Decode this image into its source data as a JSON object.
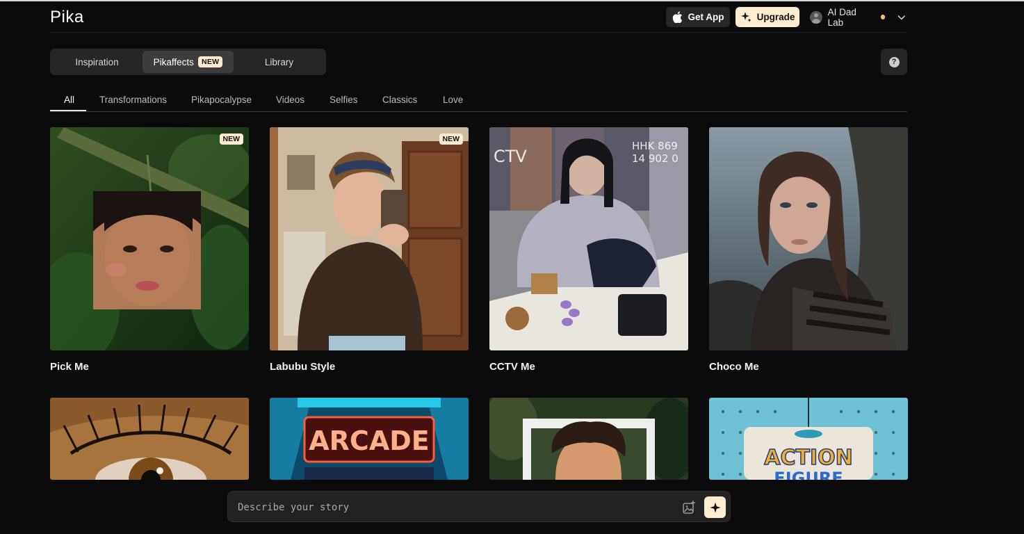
{
  "header": {
    "logo": "Pika",
    "get_app_label": "Get App",
    "upgrade_label": "Upgrade",
    "account_name": "AI Dad Lab"
  },
  "segments": {
    "items": [
      {
        "label": "Inspiration",
        "active": false
      },
      {
        "label": "Pikaffects",
        "active": true,
        "badge": "NEW"
      },
      {
        "label": "Library",
        "active": false
      }
    ]
  },
  "help_label": "?",
  "categories": [
    "All",
    "Transformations",
    "Pikapocalypse",
    "Videos",
    "Selfies",
    "Classics",
    "Love"
  ],
  "active_category": "All",
  "cards": [
    {
      "title": "Pick Me",
      "badge": "NEW"
    },
    {
      "title": "Labubu Style",
      "badge": "NEW"
    },
    {
      "title": "CCTV Me",
      "badge": ""
    },
    {
      "title": "Choco Me",
      "badge": ""
    }
  ],
  "cards_row2": [
    {
      "label": "",
      "icon": "eye-closeup-image"
    },
    {
      "label": "ARCADE",
      "icon": "arcade-sign-image"
    },
    {
      "label": "",
      "icon": "cartoon-frame-image"
    },
    {
      "label": "ACTION",
      "label2": "FIGURE",
      "icon": "action-figure-image"
    }
  ],
  "prompt": {
    "placeholder": "Describe your story"
  },
  "colors": {
    "background": "#0b0b0b",
    "accent_cream": "#fdeccd",
    "status_dot": "#f2c27a"
  }
}
